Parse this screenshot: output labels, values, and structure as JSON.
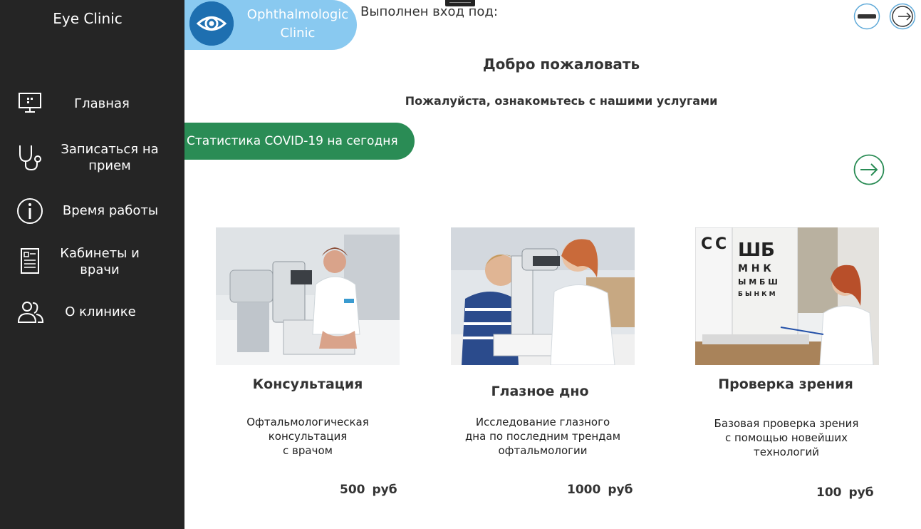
{
  "sidebar": {
    "app_title": "Eye Clinic",
    "items": [
      {
        "label": "Главная",
        "icon": "monitor-icon"
      },
      {
        "label": "Записаться на прием",
        "icon": "stethoscope-icon"
      },
      {
        "label": "Время работы",
        "icon": "info-icon"
      },
      {
        "label": "Кабинеты и врачи",
        "icon": "document-list-icon"
      },
      {
        "label": "О клинике",
        "icon": "people-icon"
      }
    ]
  },
  "header": {
    "brand_line1": "Ophthalmologic",
    "brand_line2": "Clinic",
    "brand_icon": "eye-icon",
    "logged_in_label": "Выполнен вход под:",
    "minimize_icon": "minus-circle-icon",
    "logout_icon": "logout-arrow-icon"
  },
  "main": {
    "welcome": "Добро пожаловать",
    "subtitle": "Пожалуйста, ознакомьтесь с нашими услугами",
    "covid_button": "Статистика COVID-19 на сегодня",
    "next_icon": "arrow-right-circle-icon",
    "colors": {
      "sidebar_bg": "#252525",
      "brand_bg": "#89c9f0",
      "accent_green": "#2a8c55"
    }
  },
  "services": [
    {
      "title": "Консультация",
      "description": "Офтальмологическая\nконсультация\nс врачом",
      "price": "500",
      "currency": "руб"
    },
    {
      "title": "Глазное дно",
      "description": "Исследование глазного\nдна по последним трендам\nофтальмологии",
      "price": "1000",
      "currency": "руб"
    },
    {
      "title": "Проверка зрения",
      "description": "Базовая проверка зрения\nс помощью новейших\nтехнологий",
      "price": "100",
      "currency": "руб"
    }
  ]
}
